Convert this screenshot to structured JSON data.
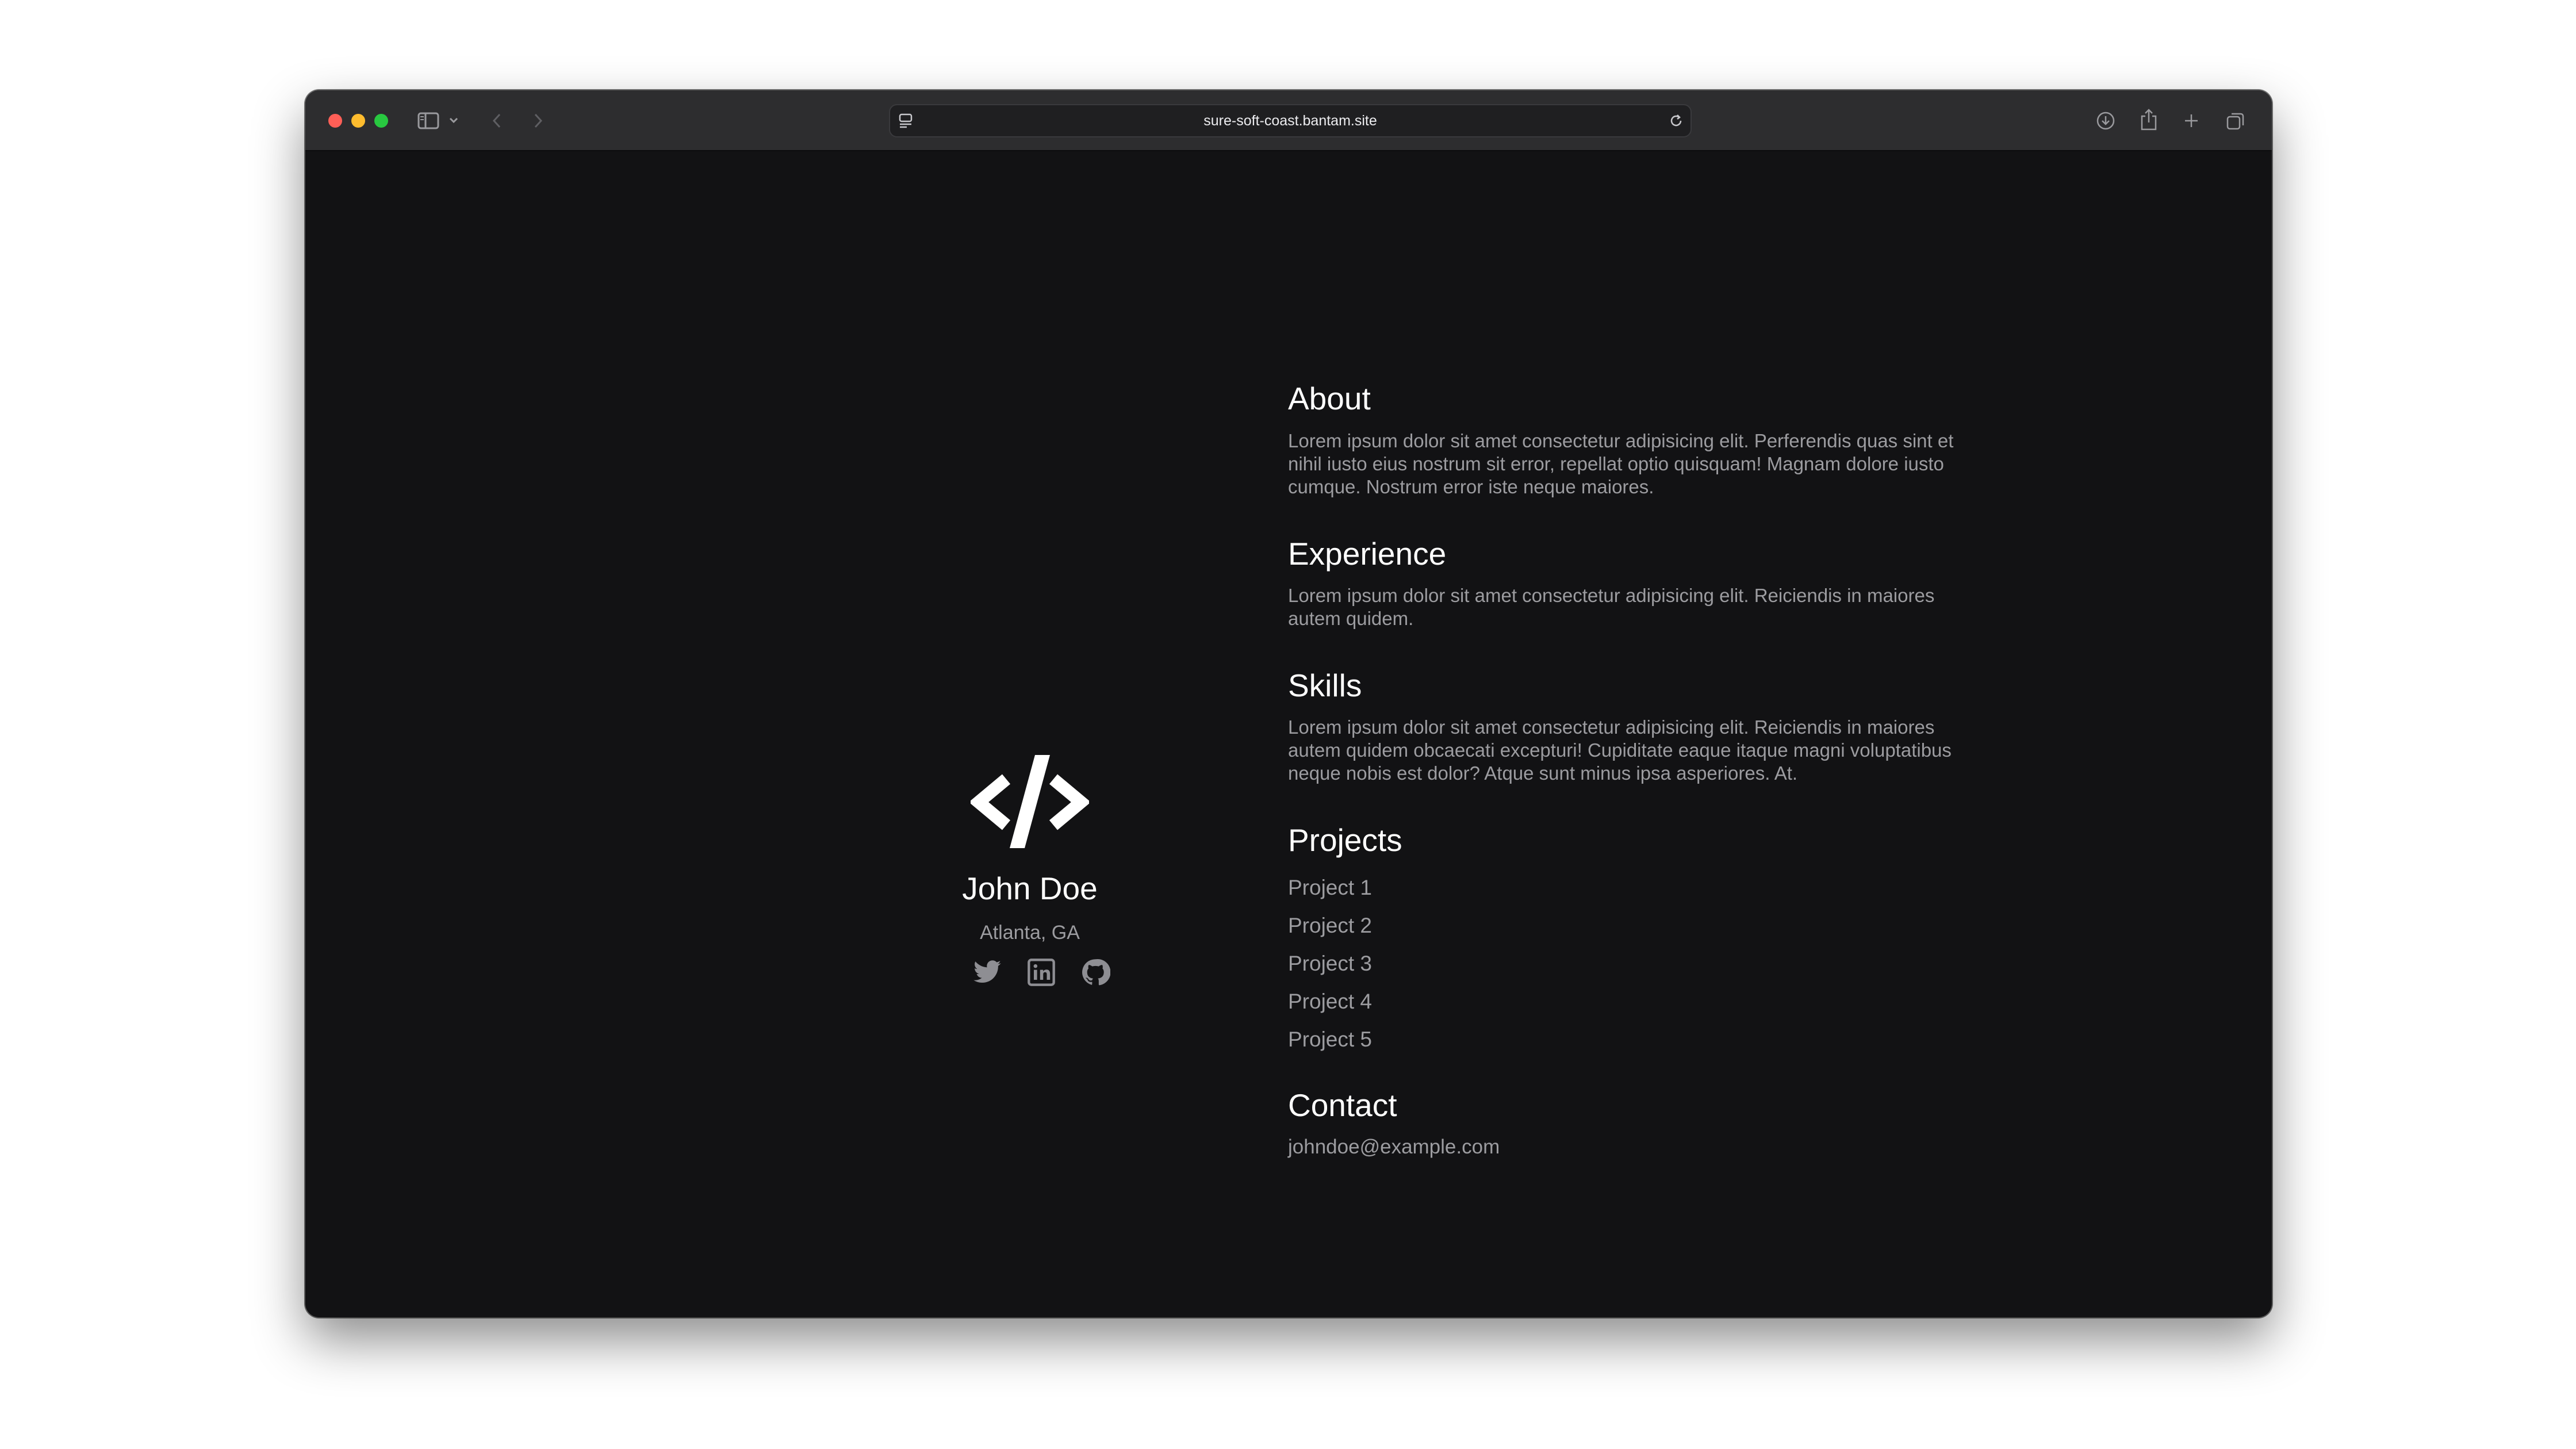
{
  "browser": {
    "url": "sure-soft-coast.bantam.site",
    "traffic_lights": {
      "close": "#ff5f57",
      "minimize": "#febc2e",
      "maximize": "#28c840"
    },
    "icons": {
      "sidebar": "sidebar-icon",
      "sidebar_menu": "chevron-down-icon",
      "back": "chevron-left-icon",
      "forward": "chevron-right-icon",
      "site_settings": "page-settings-icon",
      "reload": "reload-icon",
      "download": "download-icon",
      "share": "share-icon",
      "new_tab": "plus-icon",
      "tabs": "tab-overview-icon"
    }
  },
  "profile": {
    "logo_icon": "code-icon",
    "name": "John Doe",
    "location": "Atlanta, GA",
    "socials": [
      "twitter-icon",
      "linkedin-icon",
      "github-icon"
    ]
  },
  "sections": {
    "about": {
      "heading": "About",
      "text": "Lorem ipsum dolor sit amet consectetur adipisicing elit. Perferendis quas sint et nihil iusto eius nostrum sit error, repellat optio quisquam! Magnam dolore iusto cumque. Nostrum error iste neque maiores."
    },
    "experience": {
      "heading": "Experience",
      "text": "Lorem ipsum dolor sit amet consectetur adipisicing elit. Reiciendis in maiores autem quidem."
    },
    "skills": {
      "heading": "Skills",
      "text": "Lorem ipsum dolor sit amet consectetur adipisicing elit. Reiciendis in maiores autem quidem obcaecati excepturi! Cupiditate eaque itaque magni voluptatibus neque nobis est dolor? Atque sunt minus ipsa asperiores. At."
    },
    "projects": {
      "heading": "Projects",
      "items": [
        "Project 1",
        "Project 2",
        "Project 3",
        "Project 4",
        "Project 5"
      ]
    },
    "contact": {
      "heading": "Contact",
      "email": "johndoe@example.com"
    }
  },
  "colors": {
    "page_bg": "#121214",
    "heading": "#ffffff",
    "body_text": "#9c9ca0"
  }
}
